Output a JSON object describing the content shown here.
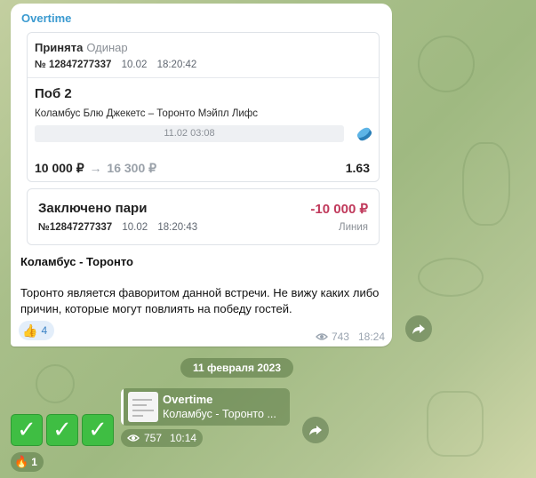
{
  "post": {
    "sender": "Overtime",
    "bet_card": {
      "status": "Принята",
      "type": "Одинар",
      "number": "№ 12847277337",
      "date": "10.02",
      "time": "18:20:42",
      "bet_name": "Поб 2",
      "teams": "Коламбус Блю Джекетс – Торонто Мэйпл Лифс",
      "event_datetime": "11.02 03:08",
      "stake": "10 000 ₽",
      "arrow": "→",
      "potential_win": "16 300 ₽",
      "odds": "1.63"
    },
    "confirm_card": {
      "title": "Заключено пари",
      "amount": "-10 000 ₽",
      "number": "№12847277337",
      "date": "10.02",
      "time": "18:20:43",
      "type": "Линия"
    },
    "title": "Коламбус - Торонто",
    "body": "Торонто является фаворитом данной встречи. Не вижу каких либо причин, которые могут повлиять на победу гостей.",
    "reaction": {
      "emoji": "👍",
      "count": "4"
    },
    "views": "743",
    "time": "18:24"
  },
  "date_separator": "11 февраля 2023",
  "second_post": {
    "checks": [
      "✓",
      "✓",
      "✓"
    ],
    "link_preview": {
      "title": "Overtime",
      "text": "Коламбус - Торонто ..."
    },
    "views": "757",
    "time": "10:14",
    "reaction": {
      "emoji": "🔥",
      "count": "1"
    }
  },
  "colors": {
    "accent": "#3a9ad0",
    "loss": "#c0395b",
    "check_green": "#3fbe43"
  }
}
